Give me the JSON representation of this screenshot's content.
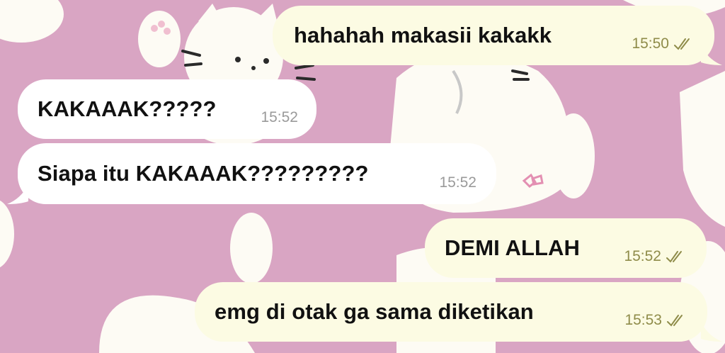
{
  "colors": {
    "wallpaper": "#d9a5c3",
    "outgoing_bubble": "#fcfbe3",
    "incoming_bubble": "#ffffff",
    "outgoing_meta": "#8f8c4a",
    "incoming_meta": "#9a9a9a"
  },
  "messages": [
    {
      "text": "hahahah makasii kakakk",
      "time": "15:50",
      "direction": "outgoing",
      "status_icon": "double-check-icon"
    },
    {
      "text": "KAKAAAK?????",
      "time": "15:52",
      "direction": "incoming"
    },
    {
      "text": "Siapa itu KAKAAAK?????????",
      "time": "15:52",
      "direction": "incoming"
    },
    {
      "text": "DEMI ALLAH",
      "time": "15:52",
      "direction": "outgoing",
      "status_icon": "double-check-icon"
    },
    {
      "text": "emg di otak ga sama diketikan",
      "time": "15:53",
      "direction": "outgoing",
      "status_icon": "double-check-icon"
    }
  ]
}
